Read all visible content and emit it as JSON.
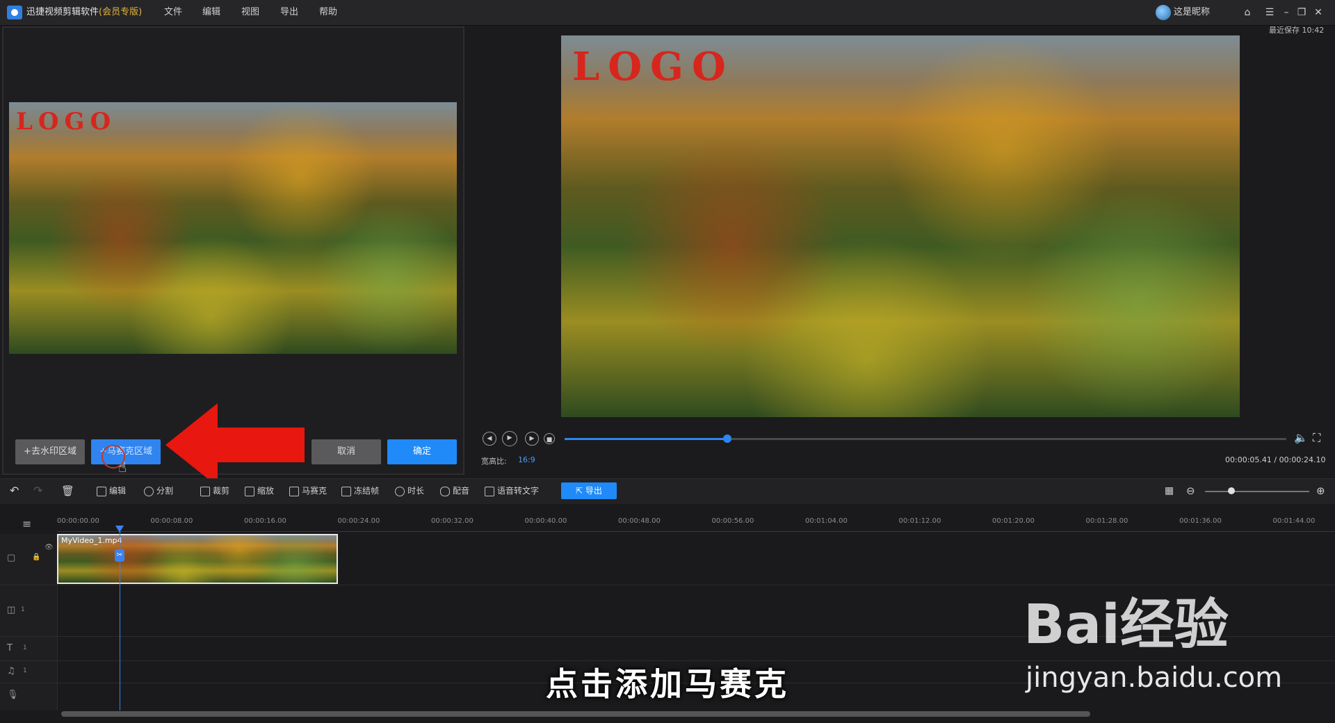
{
  "app": {
    "title": "迅捷视频剪辑软件",
    "edition": "(会员专版)",
    "menu": [
      "文件",
      "编辑",
      "视图",
      "导出",
      "帮助"
    ],
    "user_name": "这是昵称",
    "save_status": "最近保存 10:42"
  },
  "editor": {
    "logo_text": "LOGO",
    "buttons": {
      "remove_watermark": "+去水印区域",
      "mosaic_area": "+马赛克区域",
      "cancel": "取消",
      "confirm": "确定"
    }
  },
  "preview": {
    "logo_text": "LOGO",
    "ratio_label": "宽高比:",
    "ratio_value": "16:9",
    "current_time": "00:00:05.41",
    "total_time": "00:00:24.10",
    "progress": 0.2257
  },
  "toolbar": {
    "tools": [
      "编辑",
      "分割",
      "裁剪",
      "缩放",
      "马赛克",
      "冻结帧",
      "时长",
      "配音",
      "语音转文字"
    ],
    "export": "导出",
    "zoom_level": 0.25
  },
  "timeline": {
    "ticks": [
      "00:00:00.00",
      "00:00:08.00",
      "00:00:16.00",
      "00:00:24.00",
      "00:00:32.00",
      "00:00:40.00",
      "00:00:48.00",
      "00:00:56.00",
      "00:01:04.00",
      "00:01:12.00",
      "00:01:20.00",
      "00:01:28.00",
      "00:01:36.00",
      "00:01:44.00"
    ],
    "clip_name": "MyVideo_1.mp4",
    "track_counts": [
      "1",
      "1",
      "1"
    ]
  },
  "overlay": {
    "caption": "点击添加马赛克",
    "watermark_brand": "Bai经验",
    "watermark_url": "jingyan.baidu.com"
  },
  "colors": {
    "accent": "#1f8af8",
    "logo_red": "#d6261d",
    "edition_gold": "#e4b53d"
  }
}
